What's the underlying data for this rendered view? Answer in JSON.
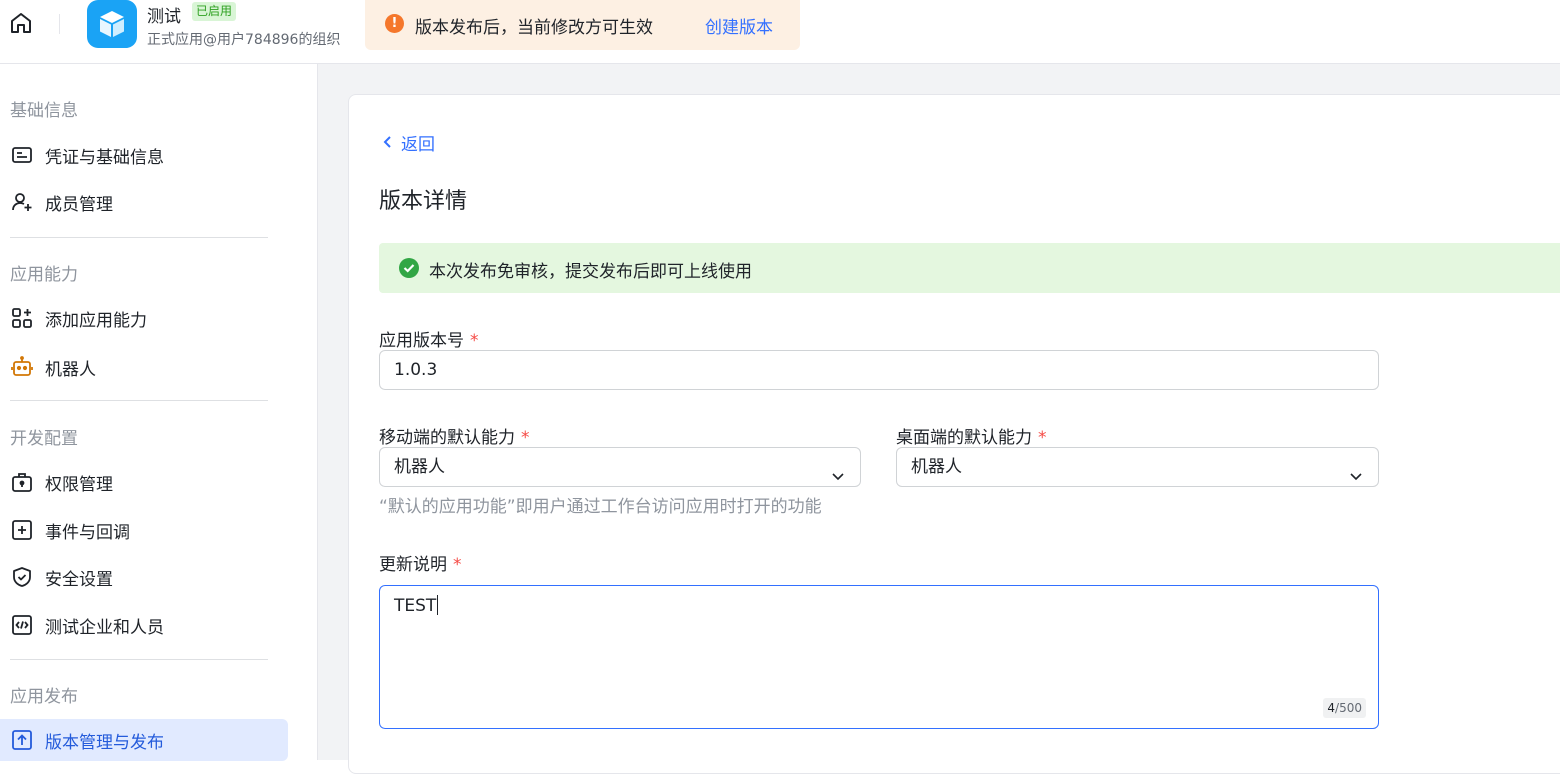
{
  "header": {
    "app_name": "测试",
    "app_status": "已启用",
    "app_org": "正式应用@用户784896的组织",
    "notice_text": "版本发布后，当前修改方可生效",
    "notice_link": "创建版本"
  },
  "sidebar": {
    "sections": [
      {
        "title": "基础信息",
        "items": [
          {
            "label": "凭证与基础信息",
            "icon": "id-card-icon"
          },
          {
            "label": "成员管理",
            "icon": "user-add-icon"
          }
        ]
      },
      {
        "title": "应用能力",
        "items": [
          {
            "label": "添加应用能力",
            "icon": "grid-add-icon"
          },
          {
            "label": "机器人",
            "icon": "robot-icon"
          }
        ]
      },
      {
        "title": "开发配置",
        "items": [
          {
            "label": "权限管理",
            "icon": "briefcase-lock-icon"
          },
          {
            "label": "事件与回调",
            "icon": "plus-square-icon"
          },
          {
            "label": "安全设置",
            "icon": "shield-check-icon"
          },
          {
            "label": "测试企业和人员",
            "icon": "code-box-icon"
          }
        ]
      },
      {
        "title": "应用发布",
        "items": [
          {
            "label": "版本管理与发布",
            "icon": "upload-box-icon",
            "active": true
          }
        ]
      }
    ]
  },
  "main": {
    "back_label": "返回",
    "title": "版本详情",
    "success_text": "本次发布免审核，提交发布后即可上线使用",
    "version_label": "应用版本号",
    "version_value": "1.0.3",
    "mobile_label": "移动端的默认能力",
    "mobile_value": "机器人",
    "desktop_label": "桌面端的默认能力",
    "desktop_value": "机器人",
    "default_help": "“默认的应用功能”即用户通过工作台访问应用时打开的功能",
    "notes_label": "更新说明",
    "notes_value": "TEST",
    "notes_count": "4",
    "notes_max": "/500",
    "required_mark": "*"
  },
  "colors": {
    "accent": "#3370ff",
    "active_bg": "#e1eaff",
    "success_bg": "#e4f7df",
    "warning_bg": "#fdf0e3",
    "required": "#f54a45"
  }
}
